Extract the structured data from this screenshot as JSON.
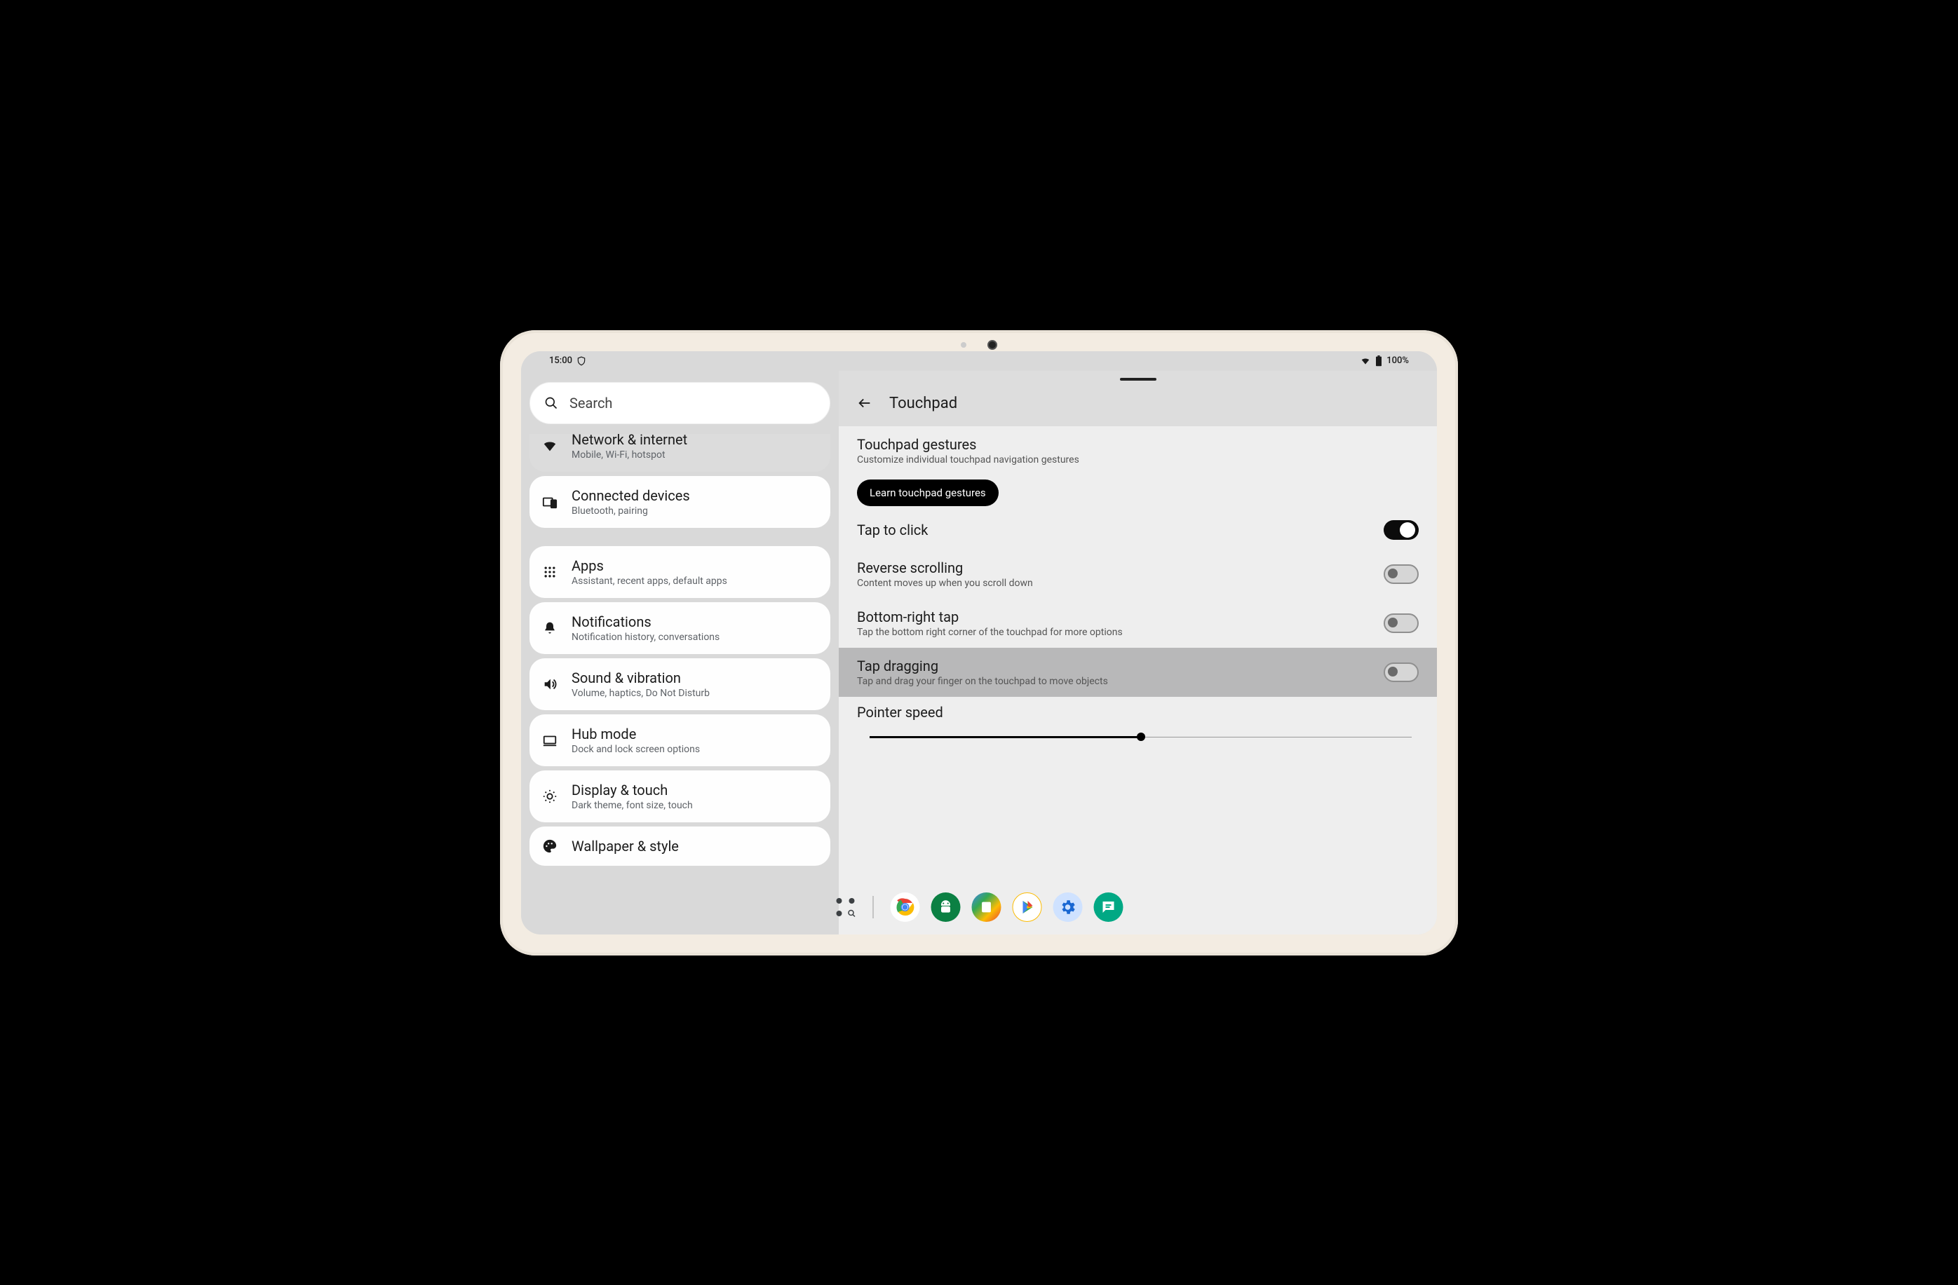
{
  "status": {
    "time": "15:00",
    "battery": "100%"
  },
  "search": {
    "placeholder": "Search"
  },
  "sidebar": {
    "items": [
      {
        "id": "network",
        "title": "Network & internet",
        "sub": "Mobile, Wi-Fi, hotspot",
        "icon": "wifi-icon",
        "active": true,
        "partial": true
      },
      {
        "id": "connected",
        "title": "Connected devices",
        "sub": "Bluetooth, pairing",
        "icon": "devices-icon",
        "active": false,
        "partial": false
      },
      {
        "id": "apps",
        "title": "Apps",
        "sub": "Assistant, recent apps, default apps",
        "icon": "grid-icon",
        "active": false,
        "partial": false,
        "group_start": true
      },
      {
        "id": "notifs",
        "title": "Notifications",
        "sub": "Notification history, conversations",
        "icon": "bell-icon",
        "active": false,
        "partial": false
      },
      {
        "id": "sound",
        "title": "Sound & vibration",
        "sub": "Volume, haptics, Do Not Disturb",
        "icon": "volume-icon",
        "active": false,
        "partial": false
      },
      {
        "id": "hub",
        "title": "Hub mode",
        "sub": "Dock and lock screen options",
        "icon": "dock-icon",
        "active": false,
        "partial": false
      },
      {
        "id": "display",
        "title": "Display & touch",
        "sub": "Dark theme, font size, touch",
        "icon": "brightness-icon",
        "active": false,
        "partial": false
      },
      {
        "id": "wallpaper",
        "title": "Wallpaper & style",
        "sub": "",
        "icon": "palette-icon",
        "active": false,
        "partial": false
      }
    ]
  },
  "detail": {
    "page_title": "Touchpad",
    "gestures_title": "Touchpad gestures",
    "gestures_sub": "Customize individual touchpad navigation gestures",
    "learn_btn": "Learn touchpad gestures",
    "settings": [
      {
        "id": "tap_click",
        "title": "Tap to click",
        "sub": "",
        "type": "toggle",
        "value": true,
        "highlight": false
      },
      {
        "id": "reverse",
        "title": "Reverse scrolling",
        "sub": "Content moves up when you scroll down",
        "type": "toggle",
        "value": false,
        "highlight": false
      },
      {
        "id": "br_tap",
        "title": "Bottom-right tap",
        "sub": "Tap the bottom right corner of the touchpad for more options",
        "type": "toggle",
        "value": false,
        "highlight": false
      },
      {
        "id": "tap_drag",
        "title": "Tap dragging",
        "sub": "Tap and drag your finger on the touchpad to move objects",
        "type": "toggle",
        "value": false,
        "highlight": true
      }
    ],
    "pointer_speed_label": "Pointer speed",
    "pointer_speed_value": 50
  },
  "taskbar": {
    "apps": [
      {
        "name": "chrome-icon"
      },
      {
        "name": "android-icon"
      },
      {
        "name": "files-icon"
      },
      {
        "name": "play-icon"
      },
      {
        "name": "settings-icon"
      },
      {
        "name": "messages-icon"
      }
    ]
  }
}
